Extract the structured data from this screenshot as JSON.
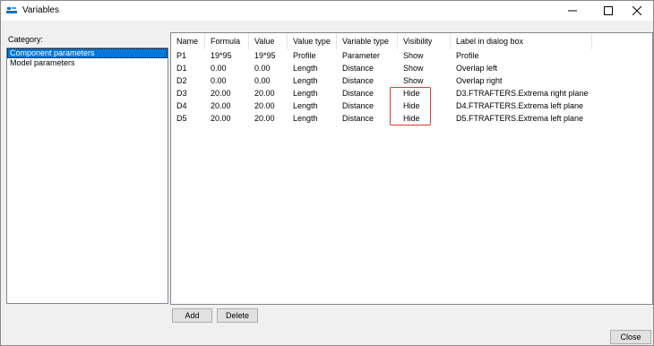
{
  "window": {
    "title": "Variables",
    "app_icon": "app-logo-icon"
  },
  "titlebar_controls": [
    "minimize-icon",
    "maximize-icon",
    "close-icon"
  ],
  "category": {
    "label": "Category:",
    "items": [
      {
        "label": "Component parameters",
        "selected": true
      },
      {
        "label": "Model parameters",
        "selected": false
      }
    ]
  },
  "table": {
    "columns": [
      "Name",
      "Formula",
      "Value",
      "Value type",
      "Variable type",
      "Visibility",
      "Label in dialog box"
    ],
    "rows": [
      [
        "P1",
        "19*95",
        "19*95",
        "Profile",
        "Parameter",
        "Show",
        "Profile"
      ],
      [
        "D1",
        "0.00",
        "0.00",
        "Length",
        "Distance",
        "Show",
        "Overlap left"
      ],
      [
        "D2",
        "0.00",
        "0.00",
        "Length",
        "Distance",
        "Show",
        "Overlap right"
      ],
      [
        "D3",
        "20.00",
        "20.00",
        "Length",
        "Distance",
        "Hide",
        "D3.FTRAFTERS.Extrema right plane"
      ],
      [
        "D4",
        "20.00",
        "20.00",
        "Length",
        "Distance",
        "Hide",
        "D4.FTRAFTERS.Extrema left plane"
      ],
      [
        "D5",
        "20.00",
        "20.00",
        "Length",
        "Distance",
        "Hide",
        "D5.FTRAFTERS.Extrema left plane"
      ]
    ],
    "highlight_color": "#e53935"
  },
  "buttons": {
    "add": "Add",
    "delete": "Delete",
    "close": "Close"
  },
  "colors": {
    "selection": "#0078d7",
    "window_bg": "#f0f0f0"
  }
}
